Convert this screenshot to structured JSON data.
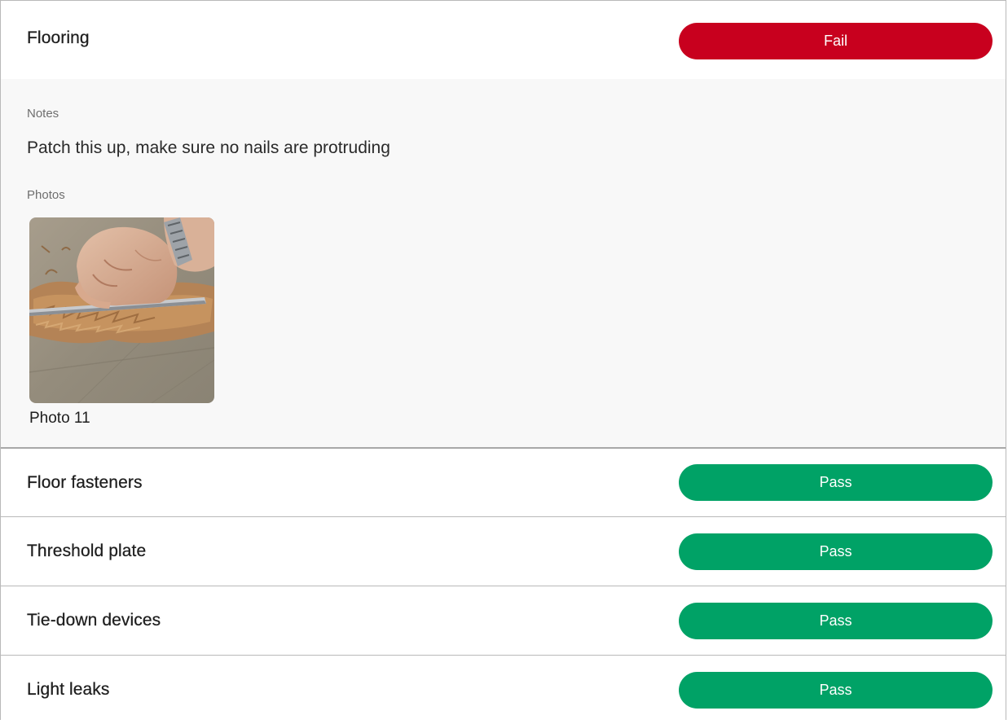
{
  "sections": {
    "flooring": {
      "title": "Flooring",
      "status": "Fail",
      "status_color": "#c8001e",
      "notes_label": "Notes",
      "notes": "Patch this up, make sure no nails are protruding",
      "photos_label": "Photos",
      "photos": [
        {
          "caption": "Photo 11",
          "subject": "hand scraping damaged wood floor"
        }
      ]
    },
    "items": [
      {
        "title": "Floor fasteners",
        "status": "Pass"
      },
      {
        "title": "Threshold plate",
        "status": "Pass"
      },
      {
        "title": "Tie-down devices",
        "status": "Pass"
      },
      {
        "title": "Light leaks",
        "status": "Pass"
      }
    ],
    "pass_color": "#00a266"
  }
}
